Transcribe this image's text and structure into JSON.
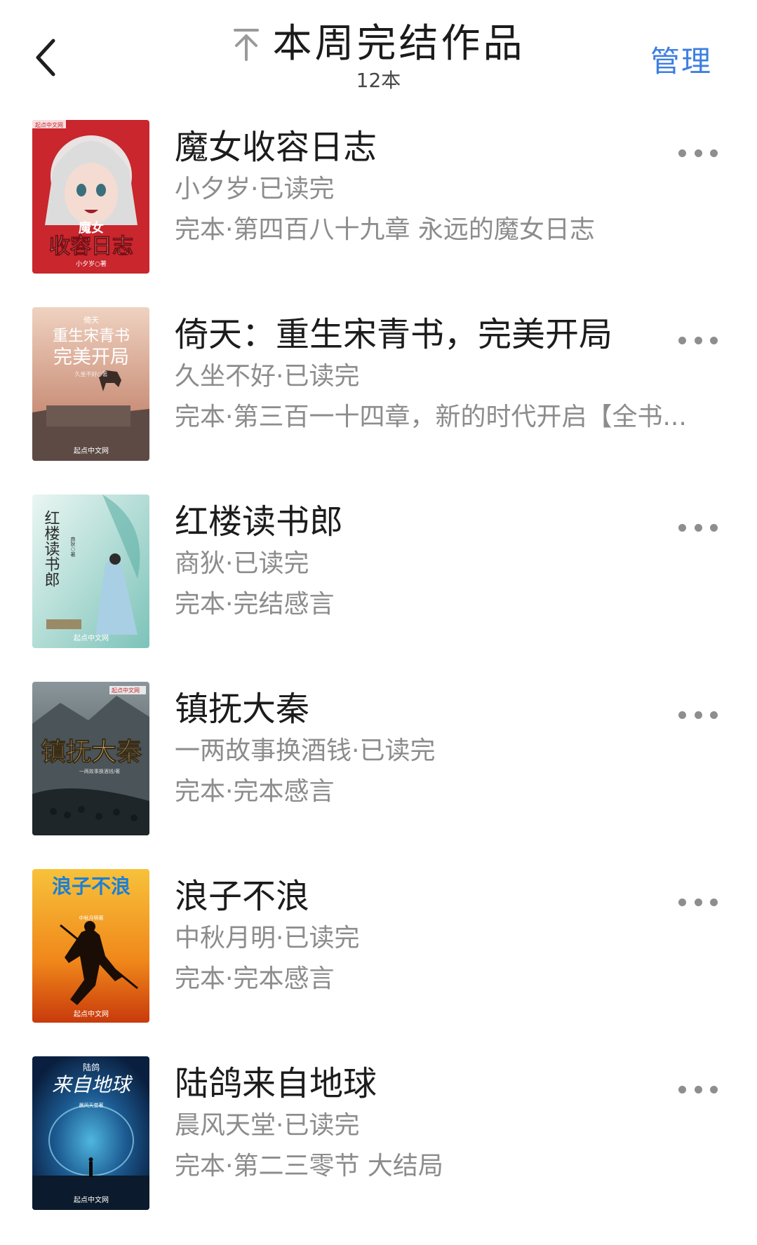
{
  "header": {
    "title": "本周完结作品",
    "count": "12本",
    "manage": "管理",
    "back_icon": "chevron-left-icon",
    "top_icon": "arrow-up-to-top-icon",
    "accent_color": "#3d7fe0"
  },
  "books": [
    {
      "title": "魔女收容日志",
      "author": "小夕岁·已读完",
      "chapter": "完本·第四百八十九章 永远的魔女日志",
      "cover": {
        "line1": "魔女",
        "line2": "收容日志",
        "author": "小夕岁○著",
        "badge": "起点中文网",
        "colors": [
          "#c9262d",
          "#e9e3e3"
        ]
      }
    },
    {
      "title": "倚天：重生宋青书，完美开局",
      "author": "久坐不好·已读完",
      "chapter": "完本·第三百一十四章，新的时代开启【全书...",
      "cover": {
        "line1": "倚天",
        "line2": "重生宋青书",
        "line3": "完美开局",
        "author": "久坐不好○著",
        "badge": "起点中文网",
        "colors": [
          "#e7c2ad",
          "#b87058"
        ]
      }
    },
    {
      "title": "红楼读书郎",
      "author": "商狄·已读完",
      "chapter": "完本·完结感言",
      "cover": {
        "line1": "红楼读书郎",
        "author": "商狄○著",
        "badge": "起点中文网",
        "colors": [
          "#d8efe9",
          "#7cc3b9"
        ]
      }
    },
    {
      "title": "镇抚大秦",
      "author": "一两故事换酒钱·已读完",
      "chapter": "完本·完本感言",
      "cover": {
        "line1": "镇抚大秦",
        "author": "一两故事换酒钱/著",
        "badge": "起点中文网",
        "colors": [
          "#2f3b3f",
          "#8b969a"
        ]
      }
    },
    {
      "title": "浪子不浪",
      "author": "中秋月明·已读完",
      "chapter": "完本·完本感言",
      "cover": {
        "line1": "浪子不浪",
        "author": "中秋月明著",
        "badge": "起点中文网",
        "colors": [
          "#f7b322",
          "#e04b0e"
        ]
      }
    },
    {
      "title": "陆鸽来自地球",
      "author": "晨风天堂·已读完",
      "chapter": "完本·第二三零节 大结局",
      "cover": {
        "line1": "陆鸽",
        "line2": "来自地球",
        "author": "晨风天堂著",
        "badge": "起点中文网",
        "colors": [
          "#0c2a55",
          "#2e7fb8"
        ]
      }
    }
  ]
}
